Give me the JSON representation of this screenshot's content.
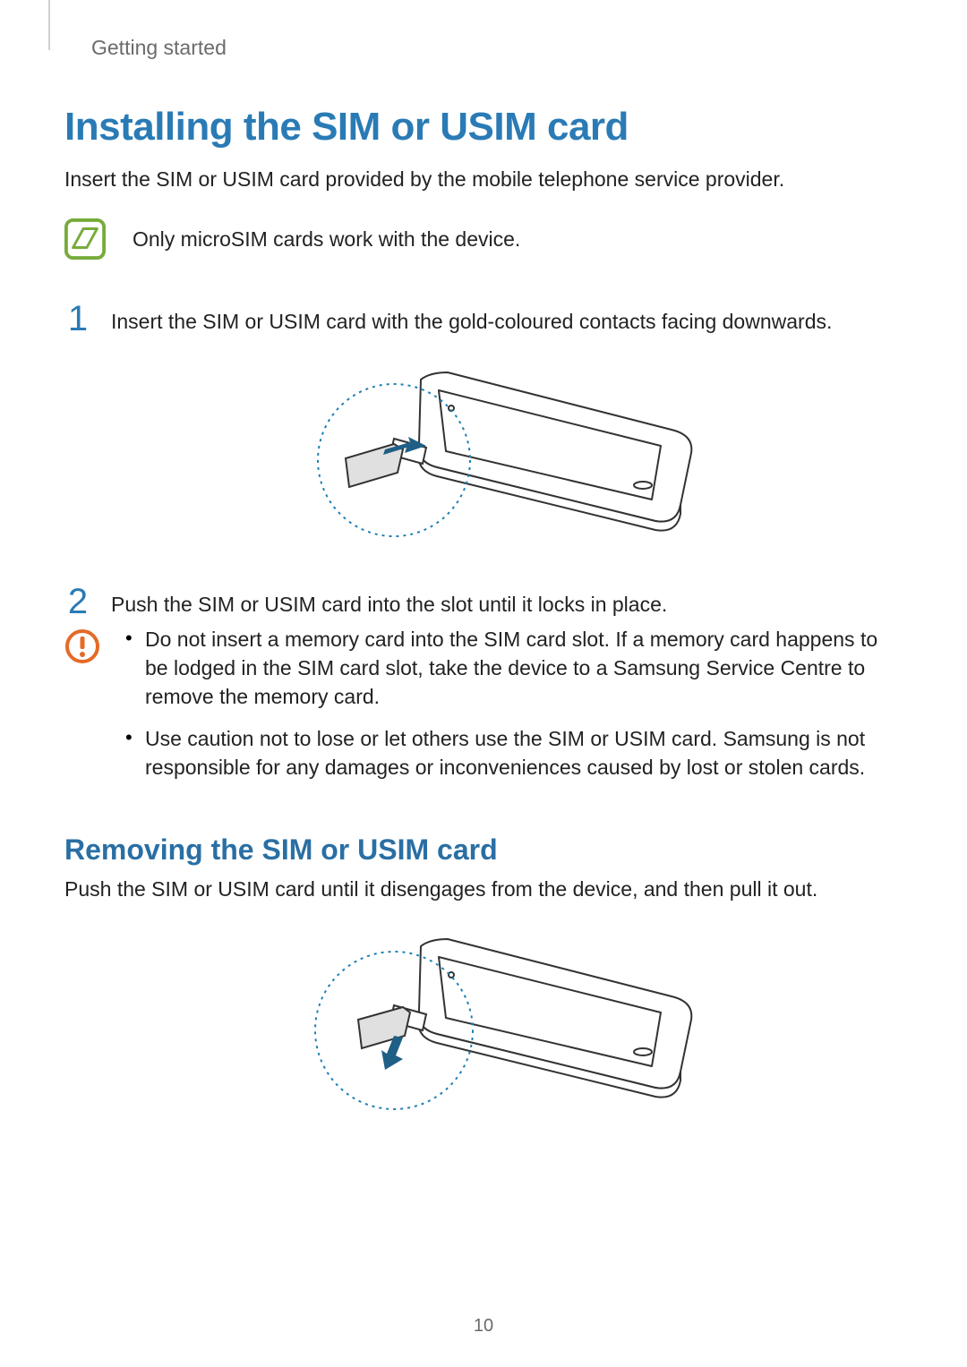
{
  "breadcrumb": "Getting started",
  "title": "Installing the SIM or USIM card",
  "intro": "Insert the SIM or USIM card provided by the mobile telephone service provider.",
  "note": "Only microSIM cards work with the device.",
  "steps": [
    {
      "num": "1",
      "text": "Insert the SIM or USIM card with the gold-coloured contacts facing downwards."
    },
    {
      "num": "2",
      "text": "Push the SIM or USIM card into the slot until it locks in place."
    }
  ],
  "cautions": [
    "Do not insert a memory card into the SIM card slot. If a memory card happens to be lodged in the SIM card slot, take the device to a Samsung Service Centre to remove the memory card.",
    "Use caution not to lose or let others use the SIM or USIM card. Samsung is not responsible for any damages or inconveniences caused by lost or stolen cards."
  ],
  "subheading": "Removing the SIM or USIM card",
  "sub_intro": "Push the SIM or USIM card until it disengages from the device, and then pull it out.",
  "page_number": "10"
}
